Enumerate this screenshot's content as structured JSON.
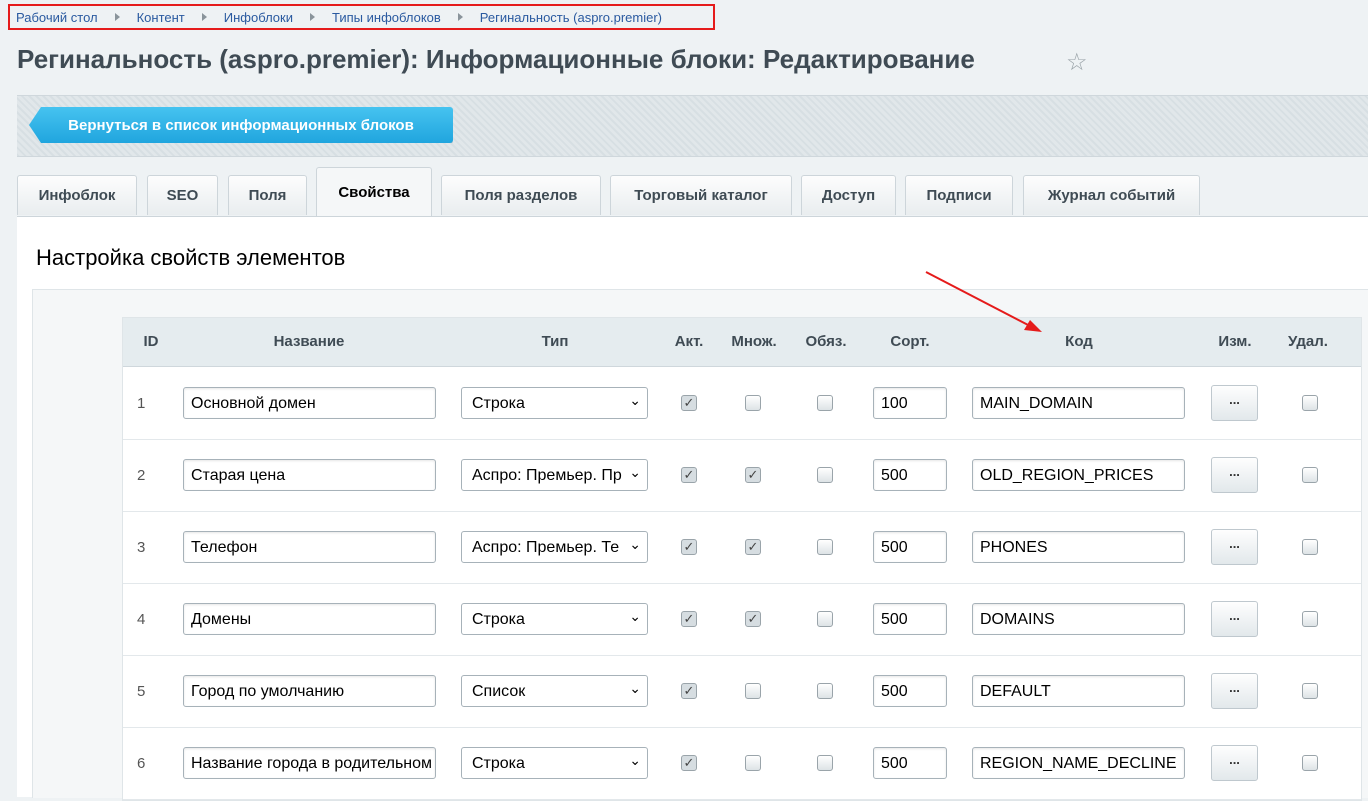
{
  "breadcrumb": [
    "Рабочий стол",
    "Контент",
    "Инфоблоки",
    "Типы инфоблоков",
    "Регинальность (aspro.premier)"
  ],
  "page_title": "Регинальность (aspro.premier): Информационные блоки: Редактирование",
  "back_button": "Вернуться в список информационных блоков",
  "tabs": [
    "Инфоблок",
    "SEO",
    "Поля",
    "Свойства",
    "Поля разделов",
    "Торговый каталог",
    "Доступ",
    "Подписи",
    "Журнал событий"
  ],
  "active_tab": "Свойства",
  "section_title": "Настройка свойств элементов",
  "columns": [
    "ID",
    "Название",
    "Тип",
    "Акт.",
    "Множ.",
    "Обяз.",
    "Сорт.",
    "Код",
    "Изм.",
    "Удал."
  ],
  "rows": [
    {
      "id": "1",
      "name": "Основной домен",
      "type": "Строка",
      "active": true,
      "multiple": false,
      "required": false,
      "sort": "100",
      "code": "MAIN_DOMAIN",
      "edit": "...",
      "delete": false
    },
    {
      "id": "2",
      "name": "Старая цена",
      "type": "Аспро: Премьер. Пр",
      "active": true,
      "multiple": true,
      "required": false,
      "sort": "500",
      "code": "OLD_REGION_PRICES",
      "edit": "...",
      "delete": false
    },
    {
      "id": "3",
      "name": "Телефон",
      "type": "Аспро: Премьер. Те",
      "active": true,
      "multiple": true,
      "required": false,
      "sort": "500",
      "code": "PHONES",
      "edit": "...",
      "delete": false
    },
    {
      "id": "4",
      "name": "Домены",
      "type": "Строка",
      "active": true,
      "multiple": true,
      "required": false,
      "sort": "500",
      "code": "DOMAINS",
      "edit": "...",
      "delete": false
    },
    {
      "id": "5",
      "name": "Город по умолчанию",
      "type": "Список",
      "active": true,
      "multiple": false,
      "required": false,
      "sort": "500",
      "code": "DEFAULT",
      "edit": "...",
      "delete": false
    },
    {
      "id": "6",
      "name": "Название города в родительном",
      "type": "Строка",
      "active": true,
      "multiple": false,
      "required": false,
      "sort": "500",
      "code": "REGION_NAME_DECLINE",
      "edit": "...",
      "delete": false
    }
  ],
  "colors": {
    "accent_button": "#20a5de",
    "highlight_border": "#e51b1b",
    "annotation_arrow": "#e51b1b"
  }
}
